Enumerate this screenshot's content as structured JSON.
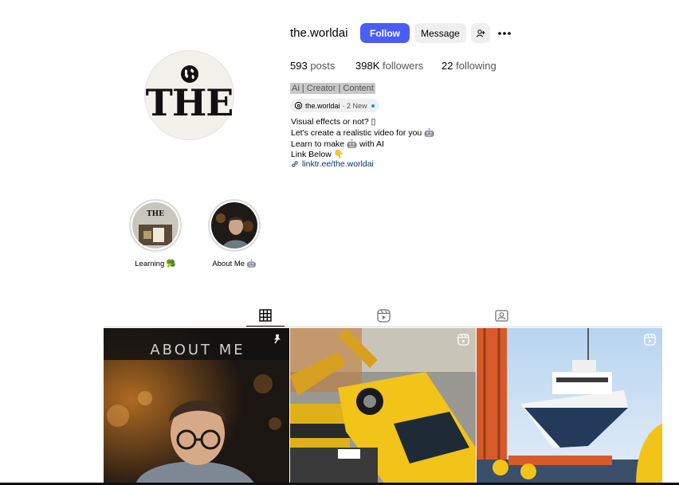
{
  "profile": {
    "username": "the.worldai",
    "avatar_text": "THE",
    "follow_label": "Follow",
    "message_label": "Message",
    "suggest_icon": "person-add-icon",
    "more_icon": "more-dots-icon"
  },
  "stats": {
    "posts_count": "593",
    "posts_label": "posts",
    "followers_count": "398K",
    "followers_label": "followers",
    "following_count": "22",
    "following_label": "following"
  },
  "bio": {
    "category": "Ai | Creator | Content",
    "threads_handle": "the.worldai",
    "threads_new": "· 2 New",
    "lines": [
      "Visual effects or not? ▯",
      "Let's create a realistic video for you 🤖",
      "Learn to make 🤖 with AI",
      "Link Below 👇"
    ],
    "link": "linktr.ee/the.worldai"
  },
  "highlights": [
    {
      "label": "Learning 🥦"
    },
    {
      "label": "About Me 🤖"
    }
  ],
  "tabs": [
    {
      "name": "posts",
      "icon": "grid-icon",
      "active": true
    },
    {
      "name": "reels",
      "icon": "reels-icon",
      "active": false
    },
    {
      "name": "tagged",
      "icon": "tagged-icon",
      "active": false
    }
  ],
  "posts": [
    {
      "overlay_text": "ABOUT ME",
      "badge_icon": "pin-icon"
    },
    {
      "overlay_text": "",
      "badge_icon": "reel-icon"
    },
    {
      "overlay_text": "",
      "badge_icon": "reel-icon"
    }
  ],
  "colors": {
    "follow_button": "#4a5df9",
    "link": "#00376b",
    "secondary_button": "#efefef"
  }
}
